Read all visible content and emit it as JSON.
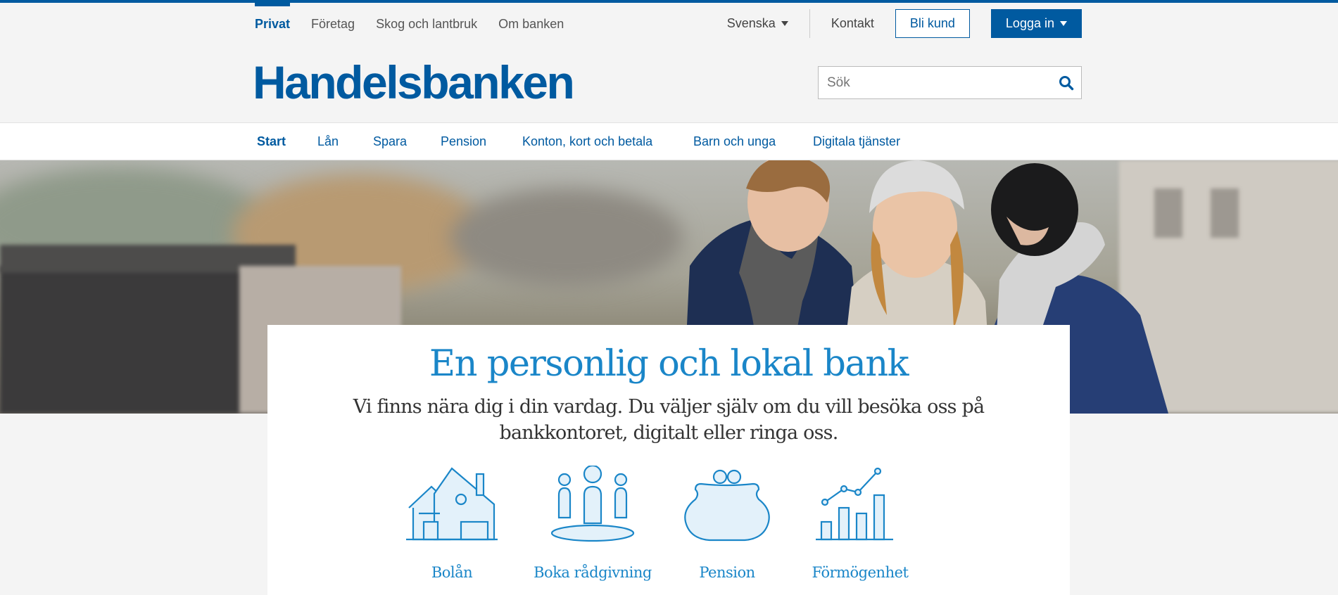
{
  "segment_nav": {
    "items": [
      {
        "label": "Privat",
        "active": true
      },
      {
        "label": "Företag",
        "active": false
      },
      {
        "label": "Skog och lantbruk",
        "active": false
      },
      {
        "label": "Om banken",
        "active": false
      }
    ]
  },
  "utility": {
    "language": "Svenska",
    "contact": "Kontakt",
    "become_customer": "Bli kund",
    "login": "Logga in"
  },
  "brand": {
    "logo_text": "Handelsbanken",
    "color": "#005aa0"
  },
  "search": {
    "placeholder": "Sök"
  },
  "main_nav": {
    "items": [
      {
        "label": "Start",
        "active": true
      },
      {
        "label": "Lån",
        "active": false
      },
      {
        "label": "Spara",
        "active": false
      },
      {
        "label": "Pension",
        "active": false
      },
      {
        "label": "Konton, kort och betala",
        "active": false
      },
      {
        "label": "Barn och unga",
        "active": false
      },
      {
        "label": "Digitala tjänster",
        "active": false
      }
    ]
  },
  "hero": {
    "image": "three-young-people-looking-at-phone-photo"
  },
  "intro": {
    "title": "En personlig och lokal bank",
    "text": "Vi finns nära dig i din vardag. Du väljer själv om du vill besöka oss på bankkontoret, digitalt eller ringa oss."
  },
  "features": [
    {
      "label": "Bolån",
      "icon": "house-icon"
    },
    {
      "label": "Boka rådgivning",
      "icon": "people-meeting-icon"
    },
    {
      "label": "Pension",
      "icon": "piggy-purse-icon"
    },
    {
      "label": "Förmögenhet",
      "icon": "growth-chart-icon"
    }
  ],
  "colors": {
    "primary": "#005aa0",
    "accent": "#1a86c8",
    "icon_fill": "#e3f1fa"
  }
}
